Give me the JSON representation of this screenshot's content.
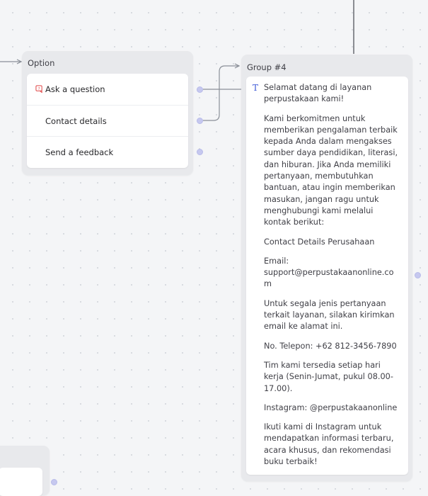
{
  "option_group": {
    "title": "Option",
    "items": [
      {
        "label": "Ask a question",
        "icon": "question-bubble-icon"
      },
      {
        "label": "Contact details"
      },
      {
        "label": "Send a feedback"
      }
    ]
  },
  "group4": {
    "title": "Group #4",
    "text_icon": "T",
    "paragraphs": [
      "Selamat datang di layanan perpustakaan kami!",
      "Kami berkomitmen untuk memberikan pengalaman terbaik kepada Anda dalam mengakses sumber daya pendidikan, literasi, dan hiburan. Jika Anda memiliki pertanyaan, membutuhkan bantuan, atau ingin memberikan masukan, jangan ragu untuk menghubungi kami melalui kontak berikut:",
      "Contact Details Perusahaan",
      "Email: support@perpustakaanonline.com",
      "Untuk segala jenis pertanyaan terkait layanan, silakan kirimkan email ke alamat ini.",
      "No. Telepon: +62 812-3456-7890",
      "Tim kami tersedia setiap hari kerja (Senin-Jumat, pukul 08.00-17.00).",
      "Instagram: @perpustakaanonline",
      "Ikuti kami di Instagram untuk mendapatkan informasi terbaru, acara khusus, dan rekomendasi buku terbaik!"
    ]
  },
  "colors": {
    "canvas": "#f4f5f7",
    "group_bg": "#e8e9ec",
    "edge": "#8a8f98",
    "handle": "#c6c8ef",
    "accent_text_icon": "#3b57d6",
    "question_icon": "#e04747"
  }
}
